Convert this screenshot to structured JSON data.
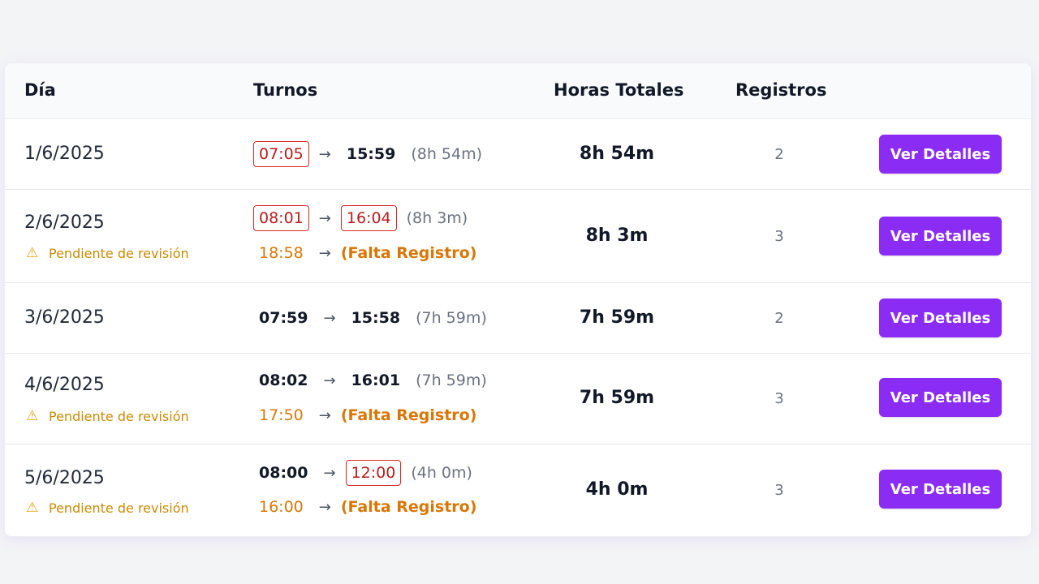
{
  "table": {
    "headers": {
      "day": "Día",
      "shifts": "Turnos",
      "total_hours": "Horas Totales",
      "records": "Registros"
    },
    "button_label": "Ver Detalles",
    "pending_label": "Pendiente de revisión",
    "missing_label": "(Falta Registro)",
    "rows": [
      {
        "date": "1/6/2025",
        "shift1": {
          "start": "07:05",
          "end": "15:59",
          "duration": "(8h 54m)"
        },
        "total": "8h 54m",
        "records": "2"
      },
      {
        "date": "2/6/2025",
        "shift1": {
          "start": "08:01",
          "end": "16:04",
          "duration": "(8h 3m)"
        },
        "shift2": {
          "start": "18:58"
        },
        "total": "8h 3m",
        "records": "3"
      },
      {
        "date": "3/6/2025",
        "shift1": {
          "start": "07:59",
          "end": "15:58",
          "duration": "(7h 59m)"
        },
        "total": "7h 59m",
        "records": "2"
      },
      {
        "date": "4/6/2025",
        "shift1": {
          "start": "08:02",
          "end": "16:01",
          "duration": "(7h 59m)"
        },
        "shift2": {
          "start": "17:50"
        },
        "total": "7h 59m",
        "records": "3"
      },
      {
        "date": "5/6/2025",
        "shift1": {
          "start": "08:00",
          "end": "12:00",
          "duration": "(4h 0m)"
        },
        "shift2": {
          "start": "16:00"
        },
        "total": "4h 0m",
        "records": "3"
      }
    ]
  },
  "icons": {
    "pending": "warning-triangle-icon",
    "arrow": "right-arrow-icon"
  },
  "colors": {
    "accent": "#8b2cf5",
    "flag_border": "#dc2626",
    "warning": "#d97706",
    "pending_text": "#ca8a04"
  }
}
